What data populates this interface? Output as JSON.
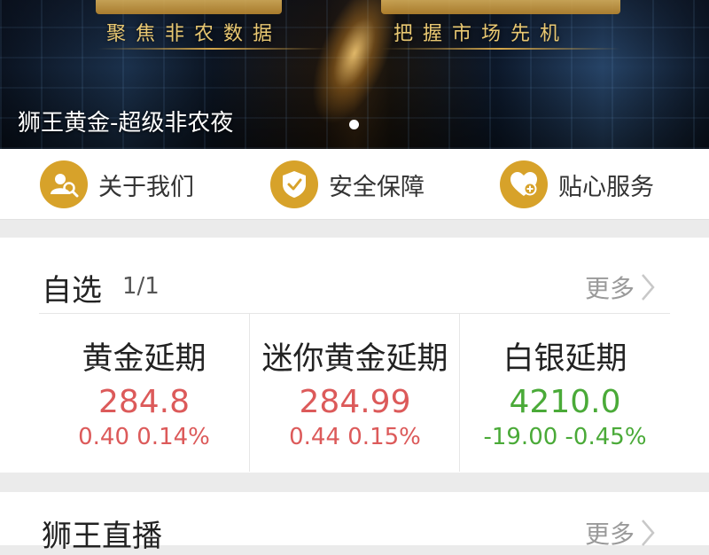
{
  "banner": {
    "caption": "狮王黄金-超级非农夜",
    "slogan_left": "聚焦非农数据",
    "slogan_right": "把握市场先机"
  },
  "features": [
    {
      "label": "关于我们",
      "icon": "about-us-icon"
    },
    {
      "label": "安全保障",
      "icon": "shield-check-icon"
    },
    {
      "label": "贴心服务",
      "icon": "heart-plus-icon"
    }
  ],
  "watchlist": {
    "title": "自选",
    "count": "1/1",
    "more_label": "更多",
    "items": [
      {
        "name": "黄金延期",
        "price": "284.8",
        "change": "0.40 0.14%",
        "trend": "up"
      },
      {
        "name": "迷你黄金延期",
        "price": "284.99",
        "change": "0.44 0.15%",
        "trend": "up"
      },
      {
        "name": "白银延期",
        "price": "4210.0",
        "change": "-19.00 -0.45%",
        "trend": "down"
      }
    ]
  },
  "live": {
    "title": "狮王直播",
    "more_label": "更多"
  },
  "colors": {
    "accent": "#d7a22a",
    "up": "#dc5a5a",
    "down": "#4aaa38"
  }
}
